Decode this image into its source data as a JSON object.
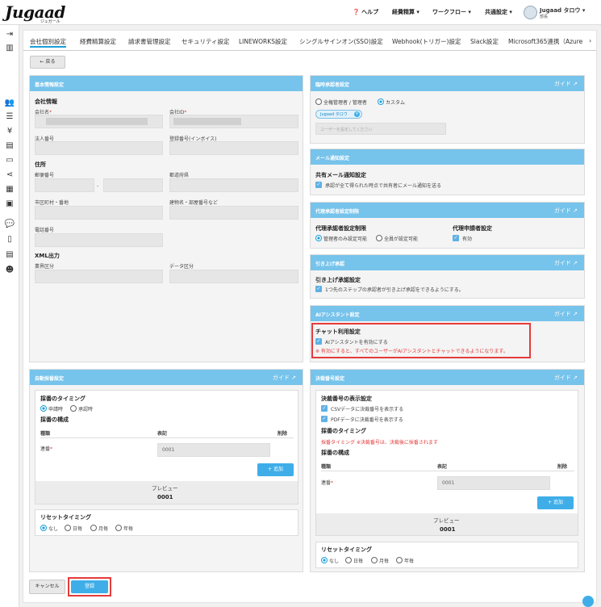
{
  "header": {
    "logo": "Jugaad",
    "logo_sub": "ジュガール",
    "help": "ヘルプ",
    "menu1": "経費精算",
    "menu2": "ワークフロー",
    "menu3": "共通設定",
    "user_name": "Jugaad タロウ",
    "user_role": "部長"
  },
  "tabs": [
    "会社個別設定",
    "経費精算設定",
    "請求書管理設定",
    "セキュリティ設定",
    "LINEWORKS設定",
    "シングルサインオン(SSO)設定",
    "Webhook(トリガー)設定",
    "Slack設定",
    "Microsoft365連携（Azure"
  ],
  "back": "戻る",
  "basic": {
    "title": "基本情報設定",
    "company_info": "会社情報",
    "company_name": "会社名",
    "company_id": "会社ID",
    "corp_number": "法人番号",
    "reg_number": "登録番号(インボイス)",
    "address": "住所",
    "postal": "郵便番号",
    "postal_sep": "-",
    "prefecture": "都道府県",
    "city": "市区町村・番地",
    "building": "建物名・部屋番号など",
    "phone": "電話番号",
    "xml": "XML出力",
    "industry": "業界区分",
    "data_div": "データ区分",
    "required": "*"
  },
  "temp_approver": {
    "title": "臨時承認者設定",
    "guide": "ガイド",
    "opt1": "全権管理者 / 管理者",
    "opt2": "カスタム",
    "tag": "Jugaad タロウ",
    "placeholder": "ユーザーを設定してください"
  },
  "mail": {
    "title": "メール通知設定",
    "sub": "共有メール通知設定",
    "check": "承認が全て得られた時点で共有者にメール通知を送る"
  },
  "proxy": {
    "title": "代理承認者設定制限",
    "guide": "ガイド",
    "sub1": "代理承認者設定制限",
    "opt1": "管理者のみ設定可能",
    "opt2": "全員が設定可能",
    "sub2": "代理申請者設定",
    "check": "有効"
  },
  "pull": {
    "title": "引き上げ承認",
    "guide": "ガイド",
    "sub": "引き上げ承認設定",
    "check": "1つ先のステップの承認者が引き上げ承認をできるようにする。"
  },
  "ai": {
    "title": "AIアシスタント設定",
    "guide": "ガイド",
    "sub": "チャット利用設定",
    "check": "AIアシスタントを有効にする",
    "note": "※ 有効にすると、すべてのユーザーがAIアシスタントとチャットできるようになります。"
  },
  "auto": {
    "title": "自動採番設定",
    "guide": "ガイド",
    "timing": "採番のタイミング",
    "t1": "申請時",
    "t2": "承認時",
    "structure": "採番の構成",
    "col_type": "種類",
    "col_notation": "表記",
    "col_delete": "削除",
    "row_label": "連番",
    "row_value": "0001",
    "add": "+ 追加",
    "preview_label": "プレビュー",
    "preview_value": "0001",
    "reset": "リセットタイミング",
    "r1": "なし",
    "r2": "日毎",
    "r3": "月毎",
    "r4": "年毎"
  },
  "decision": {
    "title": "決裁番号設定",
    "guide": "ガイド",
    "display": "決裁番号の表示設定",
    "c1": "CSVデータに決裁番号を表示する",
    "c2": "PDFデータに決裁番号を表示する",
    "timing": "採番のタイミング",
    "timing_note": "採番タイミング ※決裁番号は、決裁後に採番されます",
    "structure": "採番の構成",
    "col_type": "種類",
    "col_notation": "表記",
    "col_delete": "削除",
    "row_label": "連番",
    "row_value": "0001",
    "add": "+ 追加",
    "preview_label": "プレビュー",
    "preview_value": "0001",
    "reset": "リセットタイミング",
    "r1": "なし",
    "r2": "日毎",
    "r3": "月毎",
    "r4": "年毎"
  },
  "footer": {
    "cancel": "キャンセル",
    "save": "登録"
  }
}
